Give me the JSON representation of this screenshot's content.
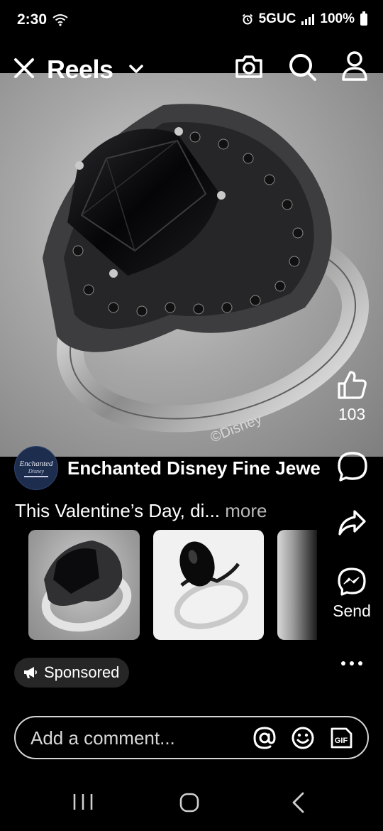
{
  "status_bar": {
    "time": "2:30",
    "network": "5GUC",
    "battery": "100%"
  },
  "header": {
    "title": "Reels",
    "icons": [
      "close-icon",
      "chevron-down-icon",
      "camera-icon",
      "search-icon",
      "profile-icon"
    ]
  },
  "post": {
    "media_watermark": "©Disney",
    "like_count": "103",
    "page_name": "Enchanted Disney Fine Jewe",
    "avatar_text": {
      "line1": "Enchanted",
      "line2": "Disney"
    },
    "caption": "This Valentine’s Day, di...",
    "caption_more": "more",
    "send_label": "Send",
    "sponsored_label": "Sponsored"
  },
  "comment_bar": {
    "placeholder": "Add a comment...",
    "gif_label": "GIF"
  },
  "colors": {
    "background": "#000000",
    "pill": "#262626",
    "secondary_text": "#b9b9b9"
  }
}
